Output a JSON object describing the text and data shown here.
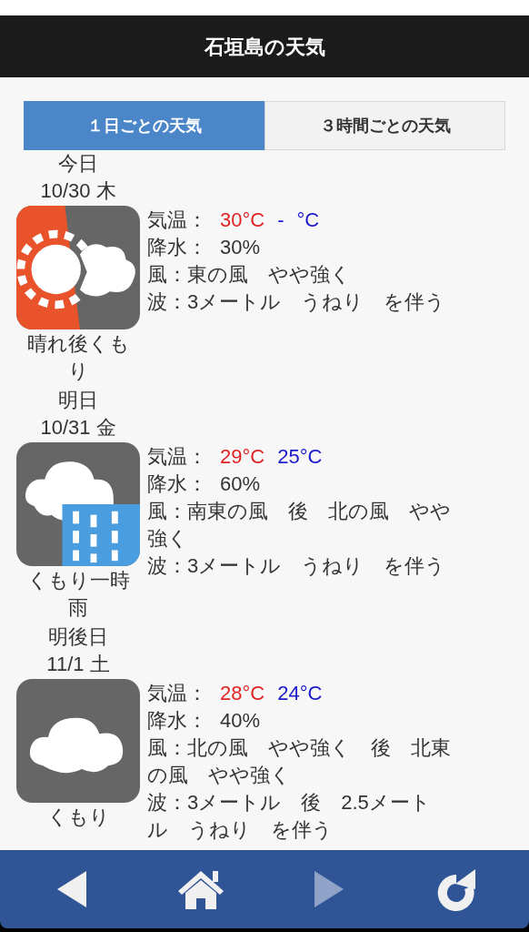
{
  "header": {
    "title": "石垣島の天気"
  },
  "tabs": [
    {
      "label": "１日ごとの天気",
      "selected": true
    },
    {
      "label": "３時間ごとの天気",
      "selected": false
    }
  ],
  "days": [
    {
      "label": "今日",
      "date": "10/30 木",
      "kind": "sun_then_cloud",
      "weather": "晴れ後くもり",
      "temp_label": "気温：",
      "high": "30°C",
      "separator": "-",
      "low": "°C",
      "precip_label": "降水：",
      "precip": "30%",
      "wind": "風：東の風　やや強く",
      "wave": "波：3メートル　うねり　を伴う"
    },
    {
      "label": "明日",
      "date": "10/31 金",
      "kind": "cloud_rain",
      "weather": "くもり一時雨",
      "temp_label": "気温：",
      "high": "29°C",
      "low": "25°C",
      "precip_label": "降水：",
      "precip": "60%",
      "wind": "風：南東の風　後　北の風　やや強く",
      "wave": "波：3メートル　うねり　を伴う"
    },
    {
      "label": "明後日",
      "date": "11/1 土",
      "kind": "cloud",
      "weather": "くもり",
      "temp_label": "気温：",
      "high": "28°C",
      "low": "24°C",
      "precip_label": "降水：",
      "precip": "40%",
      "wind": "風：北の風　やや強く　後　北東の風　やや強く",
      "wave": "波：3メートル　後　2.5メートル　うねり　を伴う"
    }
  ],
  "nav": [
    {
      "kind": "back",
      "disabled": false
    },
    {
      "kind": "home",
      "disabled": false
    },
    {
      "kind": "forward",
      "disabled": true
    },
    {
      "kind": "reload",
      "disabled": false
    }
  ]
}
